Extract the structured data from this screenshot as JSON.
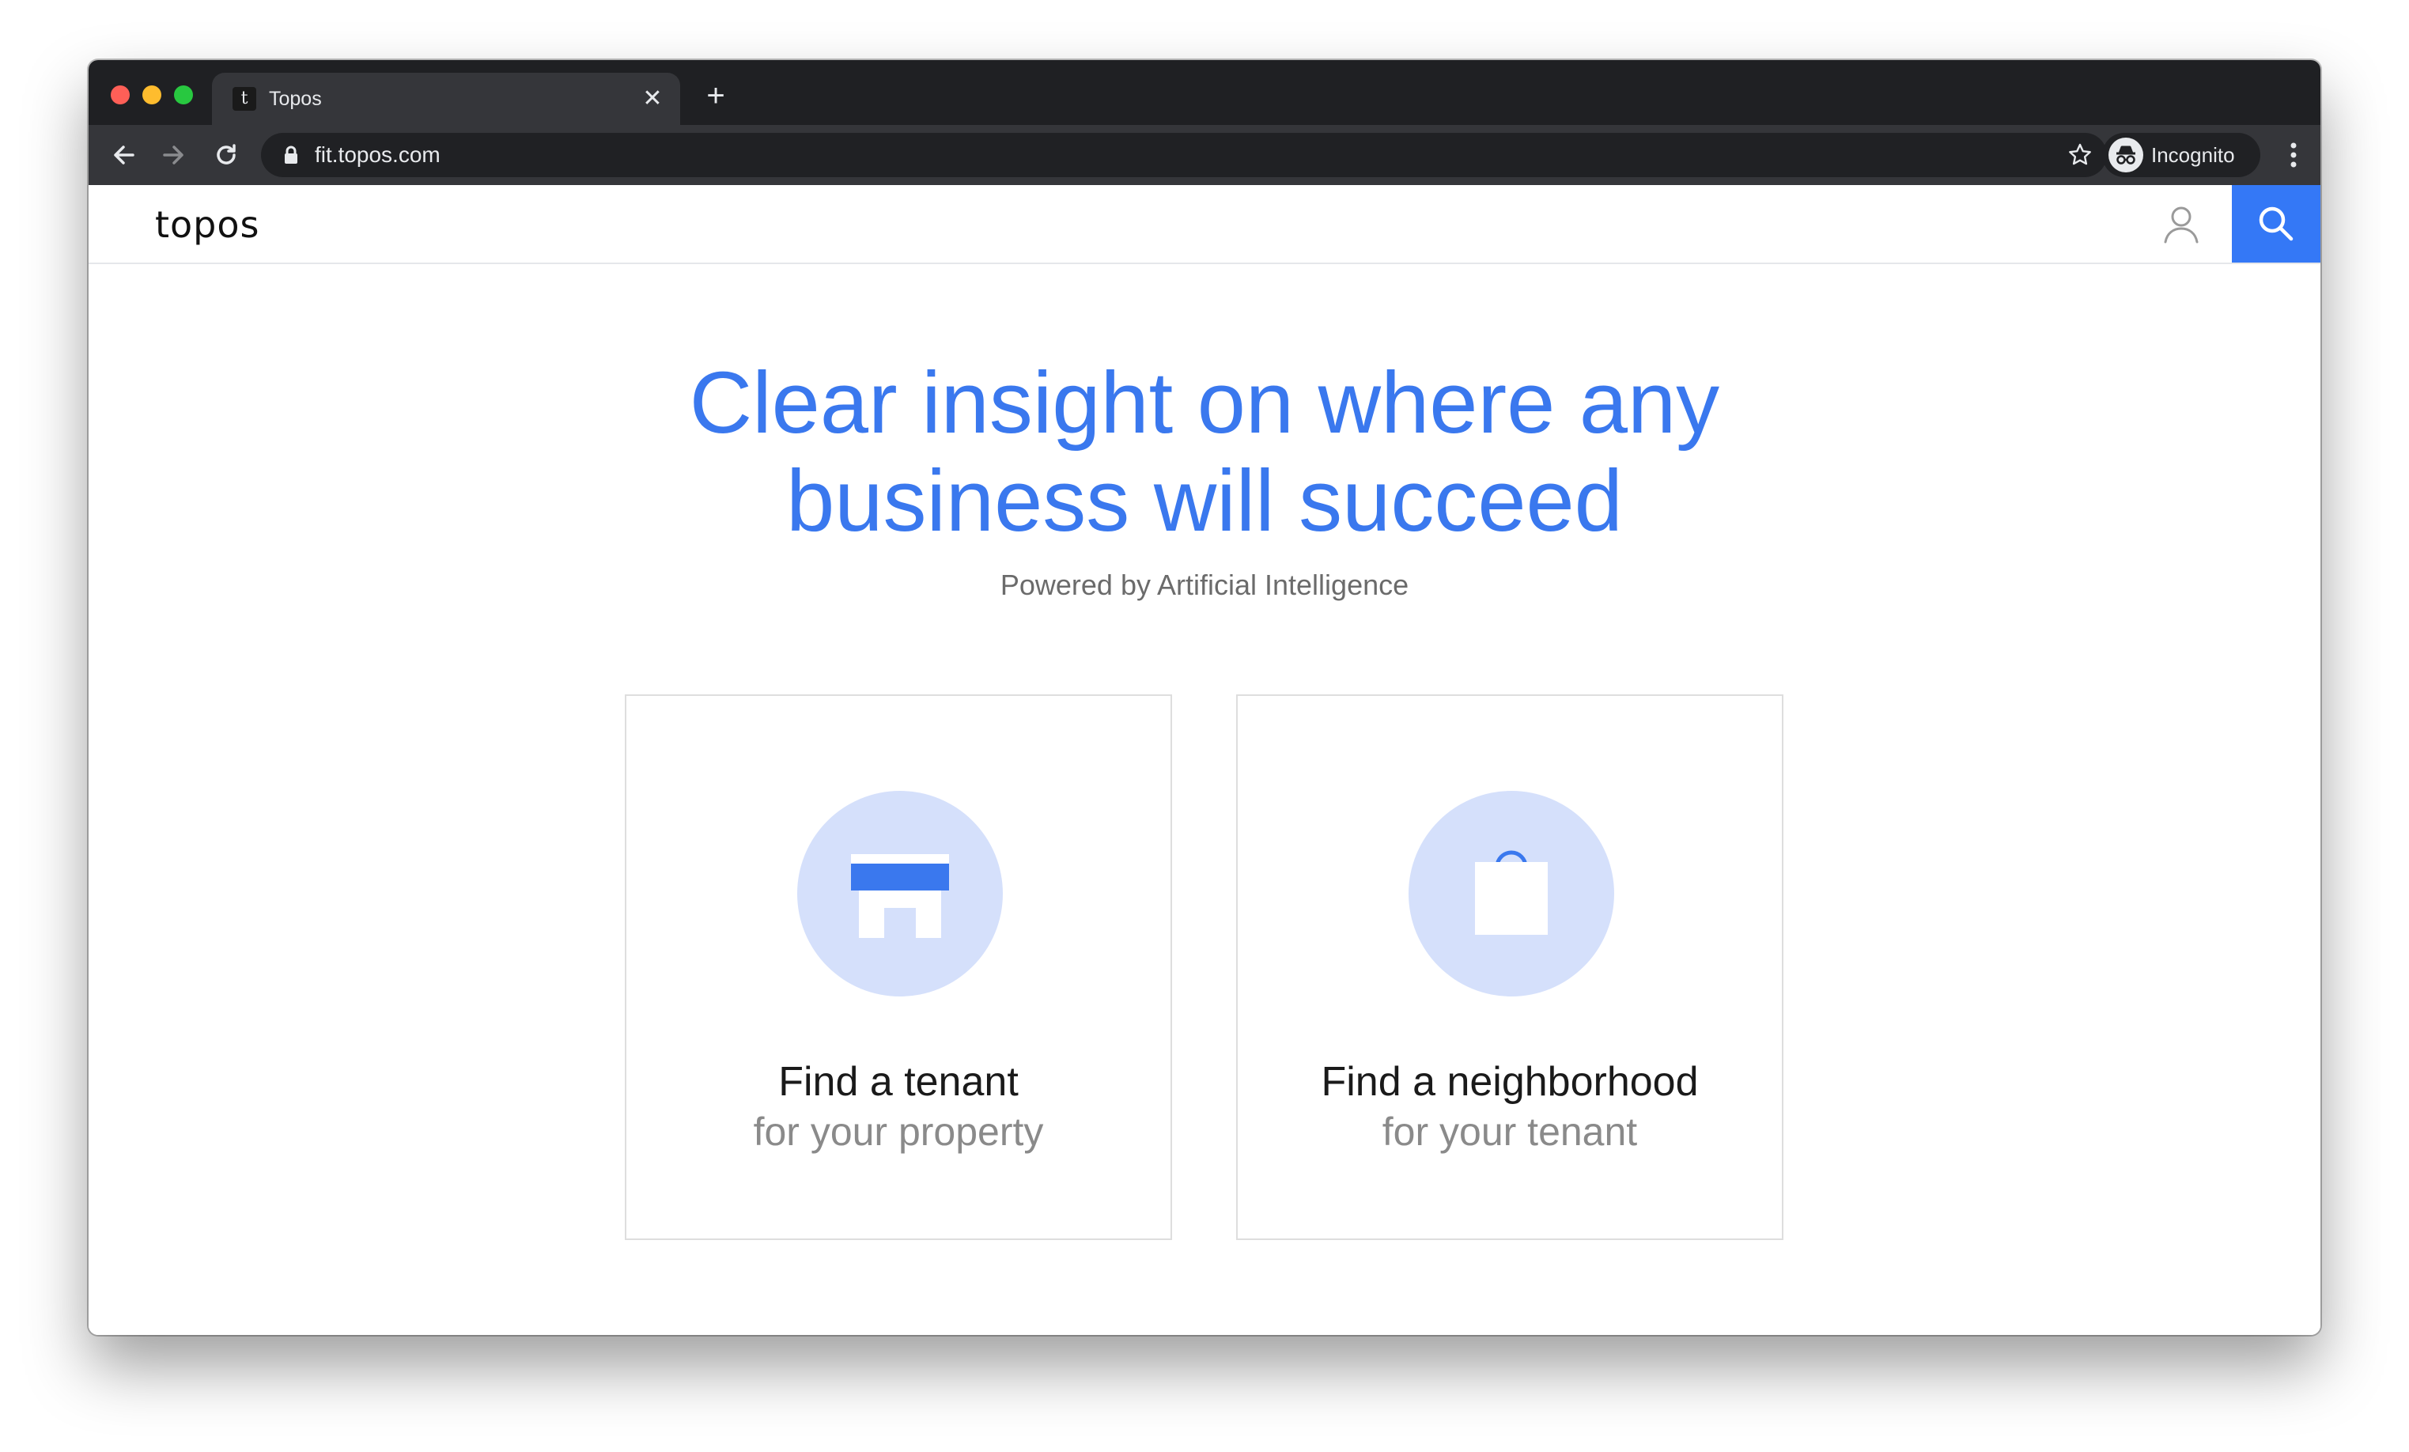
{
  "browser": {
    "tab_title": "Topos",
    "favicon_letter": "t",
    "new_tab_symbol": "+",
    "close_symbol": "✕",
    "url": "fit.topos.com",
    "incognito_label": "Incognito"
  },
  "site": {
    "logo_text": "topos",
    "accent_color": "#3478f6",
    "headline_line1": "Clear insight on where any",
    "headline_line2": "business will succeed",
    "subhead": "Powered by Artificial Intelligence"
  },
  "cards": [
    {
      "title": "Find a tenant",
      "subtitle": "for your property",
      "icon": "storefront-icon"
    },
    {
      "title": "Find a neighborhood",
      "subtitle": "for your tenant",
      "icon": "shopping-bag-icon"
    }
  ]
}
